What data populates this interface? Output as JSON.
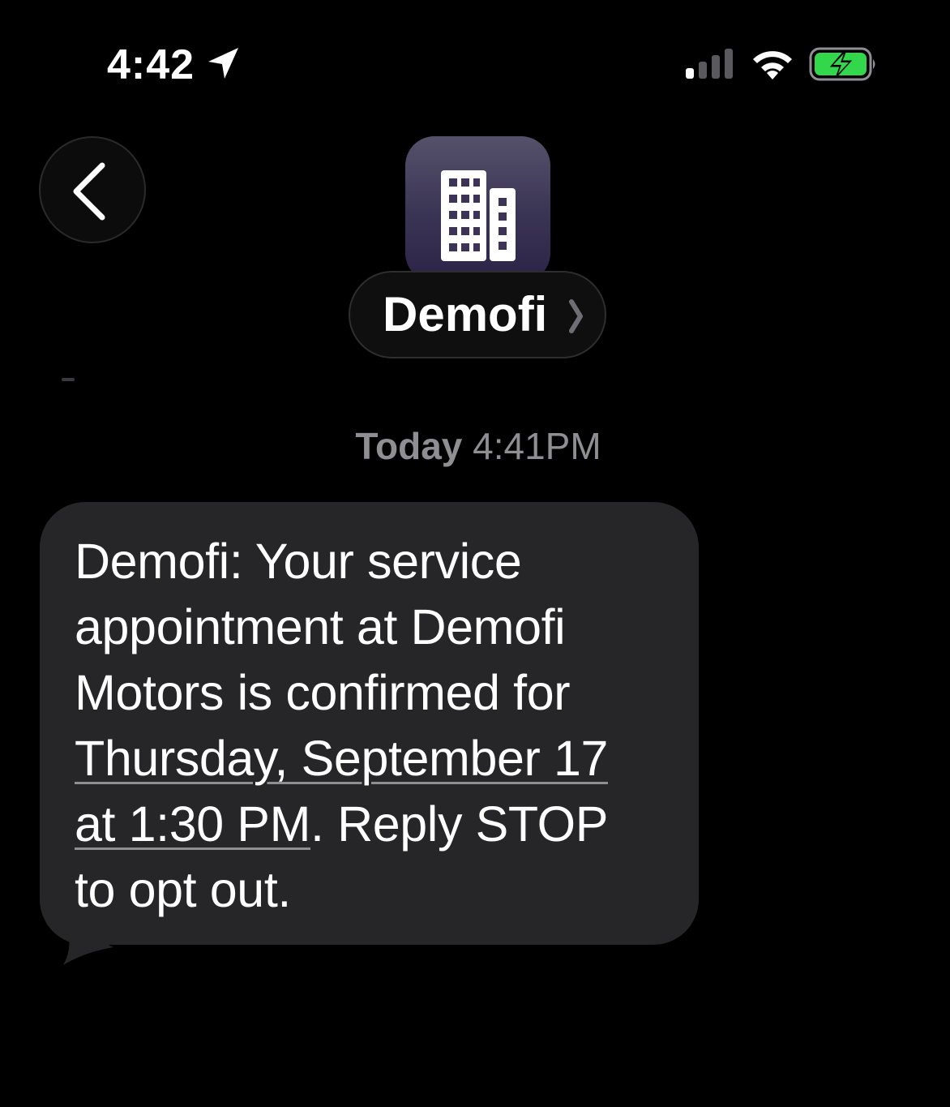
{
  "status_bar": {
    "time": "4:42",
    "icons": {
      "location": "location-arrow-icon",
      "signal": "cellular-signal-icon",
      "wifi": "wifi-icon",
      "battery": "battery-charging-icon"
    },
    "battery_color": "#32d74b"
  },
  "header": {
    "back_icon": "chevron-left-icon",
    "avatar_icon": "building-icon",
    "contact_name": "Demofi",
    "chevron": "chevron-right-icon"
  },
  "conversation": {
    "timestamp_day": "Today",
    "timestamp_time": "4:41PM",
    "messages": [
      {
        "lines": [
          "Demofi: Your service",
          "appointment at Demofi",
          "Motors is confirmed for"
        ],
        "link_line_1": "Thursday, September 17",
        "link_line_2": "at 1:30 PM",
        "after_link": ". Reply STOP",
        "last_line": "to opt out."
      }
    ]
  },
  "colors": {
    "background": "#000000",
    "bubble": "#262628",
    "timestamp": "#8e8e93",
    "avatar_gradient_top": "#55516a",
    "avatar_gradient_bottom": "#2b2347"
  }
}
